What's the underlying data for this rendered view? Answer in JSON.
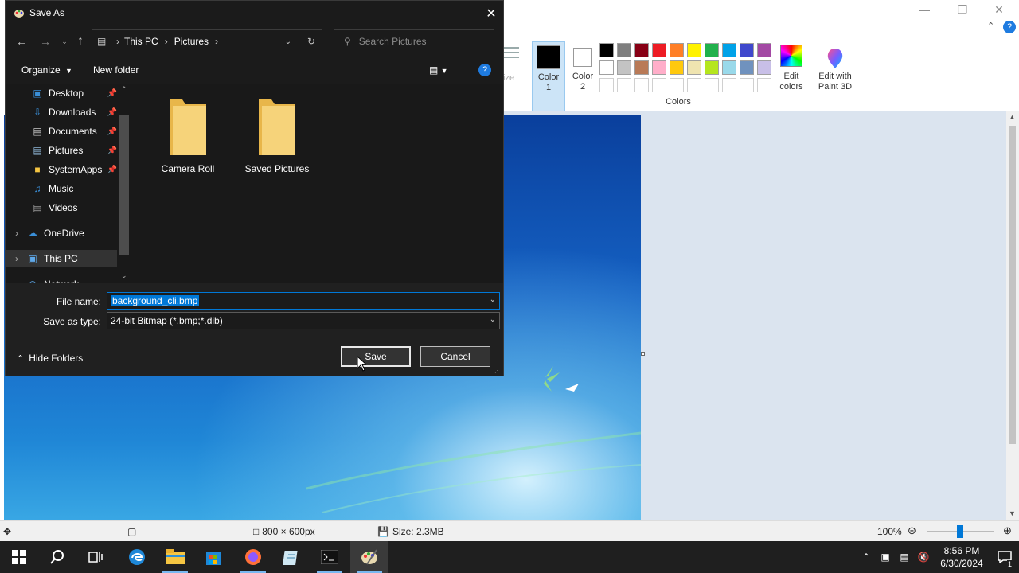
{
  "paint": {
    "ribbon": {
      "partial_label": "ize",
      "color1_label": "Color\n1",
      "color2_label": "Color\n2",
      "colors_group_label": "Colors",
      "edit_colors_label": "Edit\ncolors",
      "edit_paint3d_label": "Edit with\nPaint 3D",
      "palette_row1": [
        "#000000",
        "#7f7f7f",
        "#880015",
        "#ed1c24",
        "#ff7f27",
        "#fff200",
        "#22b14c",
        "#00a2e8",
        "#3f48cc",
        "#a349a4"
      ],
      "palette_row2": [
        "#ffffff",
        "#c3c3c3",
        "#b97a57",
        "#ffaec9",
        "#ffc90e",
        "#efe4b0",
        "#b5e61d",
        "#99d9ea",
        "#7092be",
        "#c8bfe7"
      ]
    },
    "statusbar": {
      "dimensions": "800 × 600px",
      "size": "Size: 2.3MB",
      "zoom": "100%"
    }
  },
  "dialog": {
    "title": "Save As",
    "breadcrumb": [
      "This PC",
      "Pictures"
    ],
    "search_placeholder": "Search Pictures",
    "organize_label": "Organize",
    "new_folder_label": "New folder",
    "nav_items": [
      {
        "label": "Desktop",
        "icon": "desktop-icon",
        "pinned": true
      },
      {
        "label": "Downloads",
        "icon": "download-icon",
        "pinned": true
      },
      {
        "label": "Documents",
        "icon": "document-icon",
        "pinned": true
      },
      {
        "label": "Pictures",
        "icon": "pictures-icon",
        "pinned": true
      },
      {
        "label": "SystemApps",
        "icon": "folder-icon",
        "pinned": true
      },
      {
        "label": "Music",
        "icon": "music-icon",
        "pinned": false
      },
      {
        "label": "Videos",
        "icon": "videos-icon",
        "pinned": false
      },
      {
        "label": "OneDrive",
        "icon": "cloud-icon",
        "pinned": false
      },
      {
        "label": "This PC",
        "icon": "computer-icon",
        "pinned": false
      },
      {
        "label": "Network",
        "icon": "network-icon",
        "pinned": false
      }
    ],
    "folders": [
      {
        "label": "Camera Roll"
      },
      {
        "label": "Saved Pictures"
      }
    ],
    "file_name_label": "File name:",
    "file_name_value": "background_cli.bmp",
    "save_type_label": "Save as type:",
    "save_type_value": "24-bit Bitmap (*.bmp;*.dib)",
    "hide_folders_label": "Hide Folders",
    "save_label": "Save",
    "cancel_label": "Cancel"
  },
  "taskbar": {
    "time": "8:56 PM",
    "date": "6/30/2024",
    "notification_count": "1"
  }
}
